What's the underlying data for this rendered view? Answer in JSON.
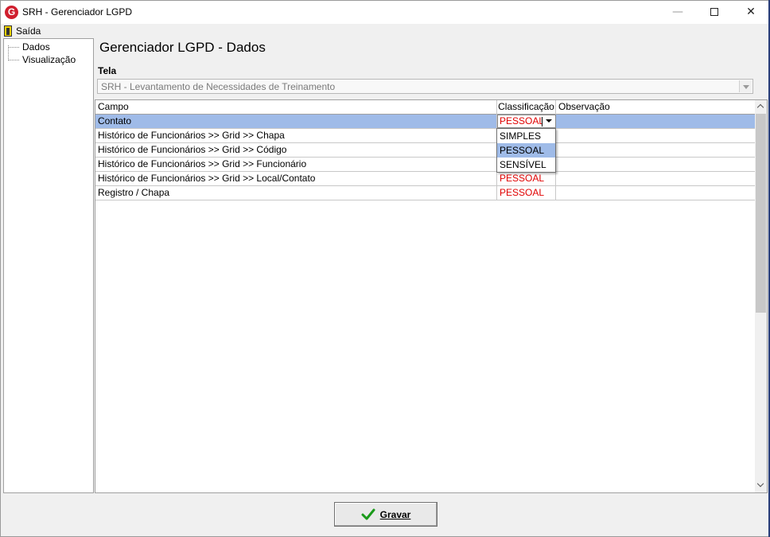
{
  "window": {
    "title": "SRH - Gerenciador LGPD",
    "logo_letter": "G",
    "minimize": "—",
    "close": "✕"
  },
  "menu": {
    "saida": "Saída"
  },
  "tree": {
    "items": [
      {
        "label": "Dados"
      },
      {
        "label": "Visualização"
      }
    ]
  },
  "main": {
    "title": "Gerenciador LGPD - Dados",
    "tela_label": "Tela",
    "tela_value": "SRH - Levantamento de Necessidades de Treinamento"
  },
  "grid": {
    "columns": [
      "Campo",
      "Classificação",
      "Observação"
    ],
    "rows": [
      {
        "campo": "Contato",
        "classificacao": "PESSOAL",
        "observacao": ""
      },
      {
        "campo": "Histórico de Funcionários >> Grid >> Chapa",
        "classificacao": "",
        "observacao": ""
      },
      {
        "campo": "Histórico de Funcionários >> Grid >> Código",
        "classificacao": "",
        "observacao": ""
      },
      {
        "campo": "Histórico de Funcionários >> Grid >> Funcionário",
        "classificacao": "",
        "observacao": ""
      },
      {
        "campo": "Histórico de Funcionários >> Grid >> Local/Contato",
        "classificacao": "PESSOAL",
        "observacao": ""
      },
      {
        "campo": "Registro / Chapa",
        "classificacao": "PESSOAL",
        "observacao": ""
      }
    ],
    "selected_row": 0
  },
  "dropdown": {
    "options": [
      "SIMPLES",
      "PESSOAL",
      "SENSÍVEL"
    ],
    "highlighted": "PESSOAL"
  },
  "footer": {
    "gravar": "Gravar"
  },
  "colors": {
    "selection": "#9fbbe8",
    "classification_text": "#e00000",
    "logo": "#d01f2e",
    "check": "#1a9a1a"
  }
}
